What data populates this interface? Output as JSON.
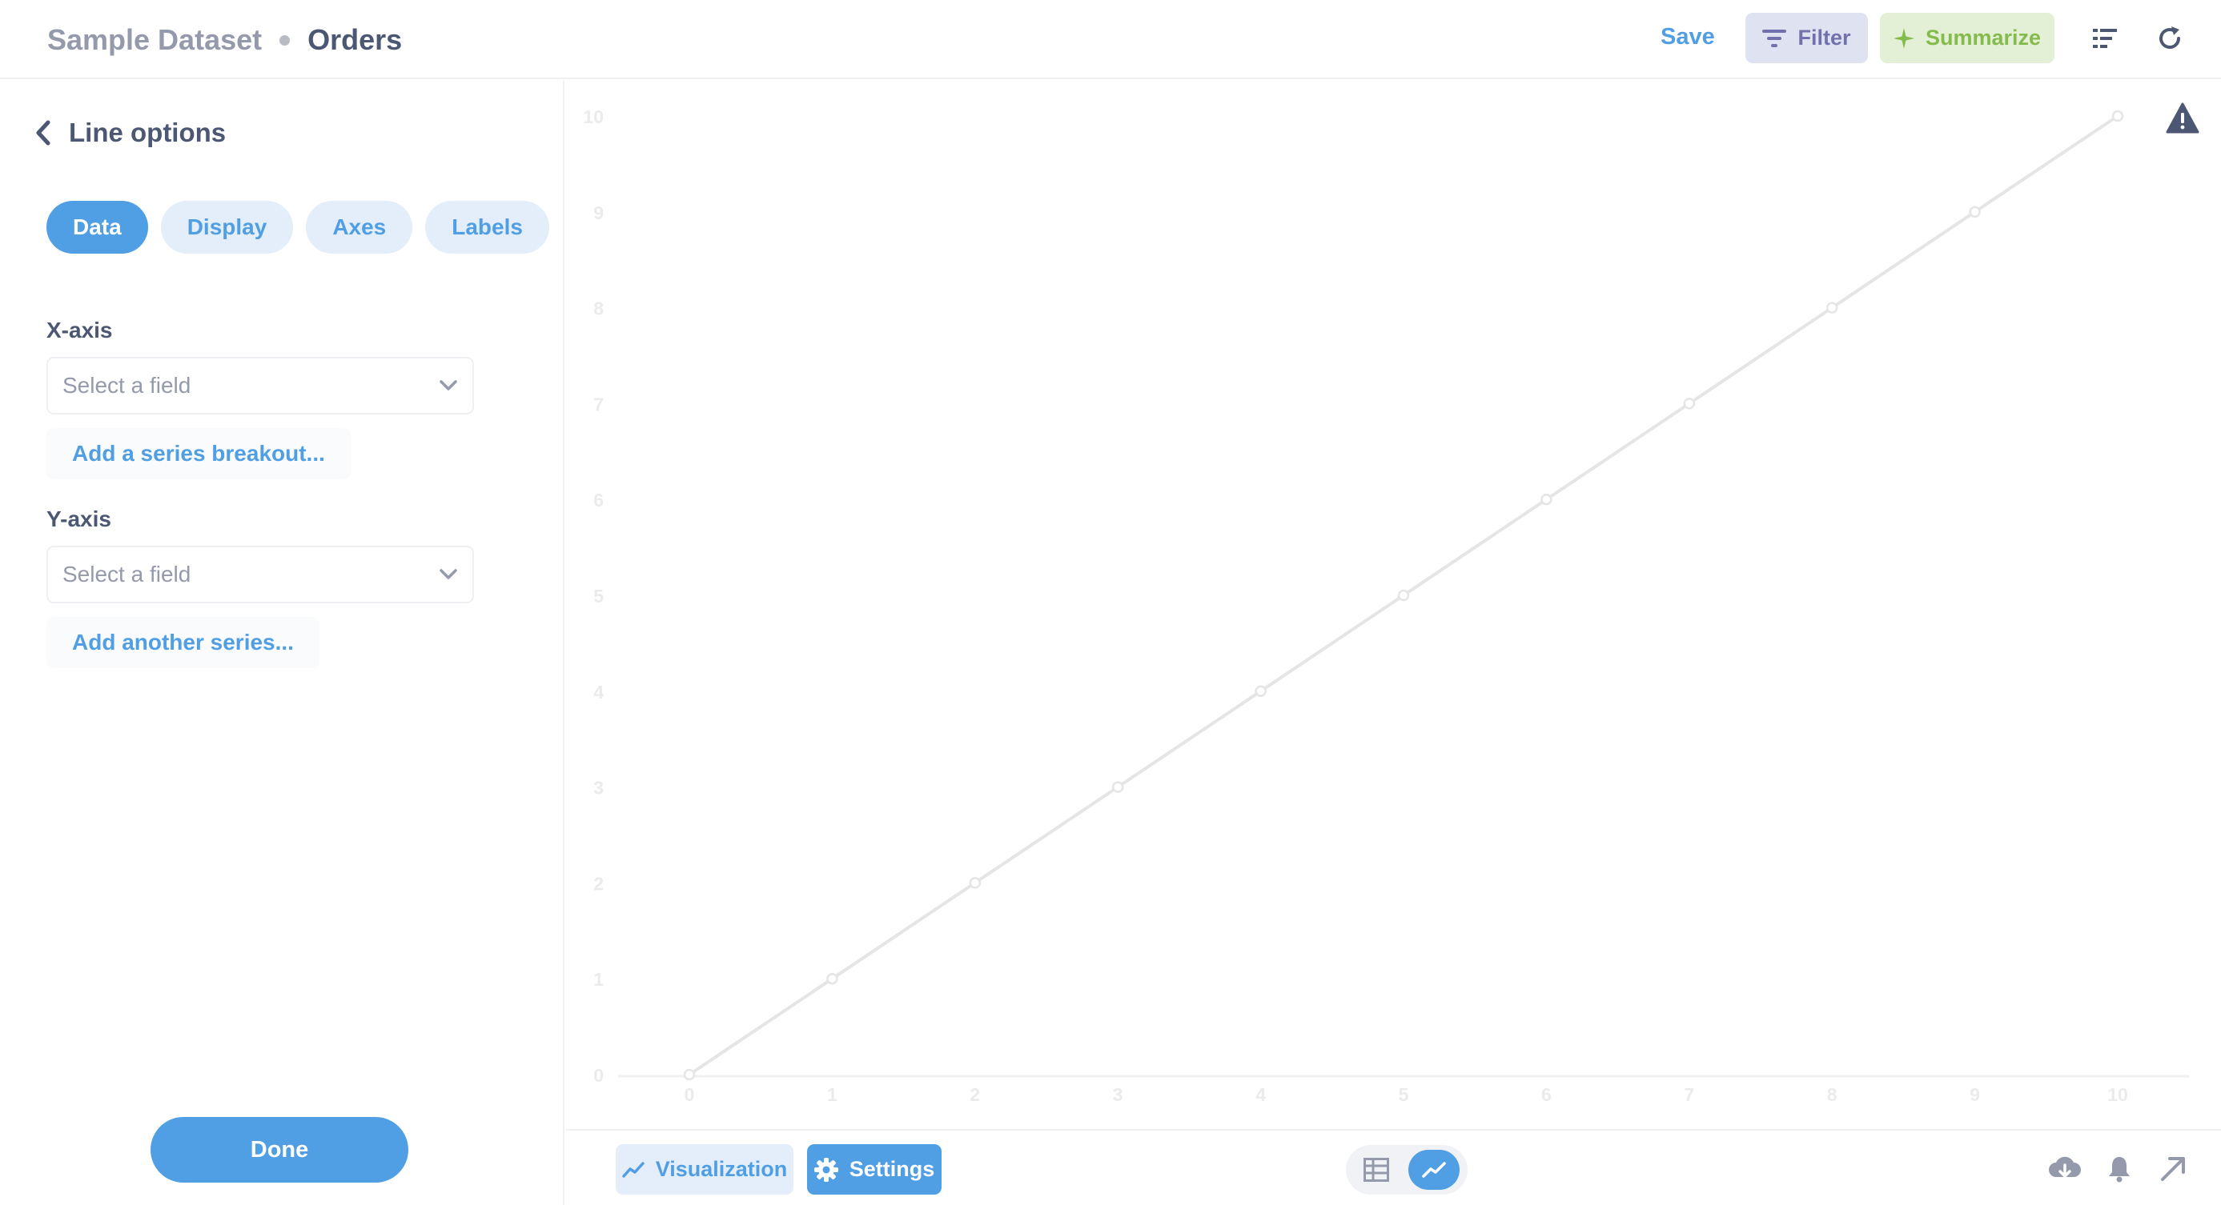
{
  "header": {
    "database": "Sample Dataset",
    "table": "Orders",
    "save_label": "Save",
    "filter_label": "Filter",
    "summarize_label": "Summarize"
  },
  "sidebar": {
    "title": "Line options",
    "tabs": [
      {
        "label": "Data",
        "active": true
      },
      {
        "label": "Display",
        "active": false
      },
      {
        "label": "Axes",
        "active": false
      },
      {
        "label": "Labels",
        "active": false
      }
    ],
    "x_axis": {
      "label": "X-axis",
      "placeholder": "Select a field",
      "add_link": "Add a series breakout..."
    },
    "y_axis": {
      "label": "Y-axis",
      "placeholder": "Select a field",
      "add_link": "Add another series..."
    },
    "done_label": "Done"
  },
  "footer": {
    "visualization_label": "Visualization",
    "settings_label": "Settings"
  },
  "colors": {
    "brand": "#509ee3",
    "filter": "#7172ad",
    "summarize": "#84bb4c",
    "chart_line": "#e5e5e5"
  },
  "chart_data": {
    "type": "line",
    "title": "",
    "xlabel": "",
    "ylabel": "",
    "x": [
      0,
      1,
      2,
      3,
      4,
      5,
      6,
      7,
      8,
      9,
      10
    ],
    "series": [
      {
        "values": [
          0,
          1,
          2,
          3,
          4,
          5,
          6,
          7,
          8,
          9,
          10
        ]
      }
    ],
    "xticks": [
      "0",
      "1",
      "2",
      "3",
      "4",
      "5",
      "6",
      "7",
      "8",
      "9",
      "10"
    ],
    "yticks": [
      "0",
      "1",
      "2",
      "3",
      "4",
      "5",
      "6",
      "7",
      "8",
      "9",
      "10"
    ],
    "xlim": [
      0,
      10
    ],
    "ylim": [
      0,
      10
    ],
    "grid": false,
    "placeholder": true
  }
}
